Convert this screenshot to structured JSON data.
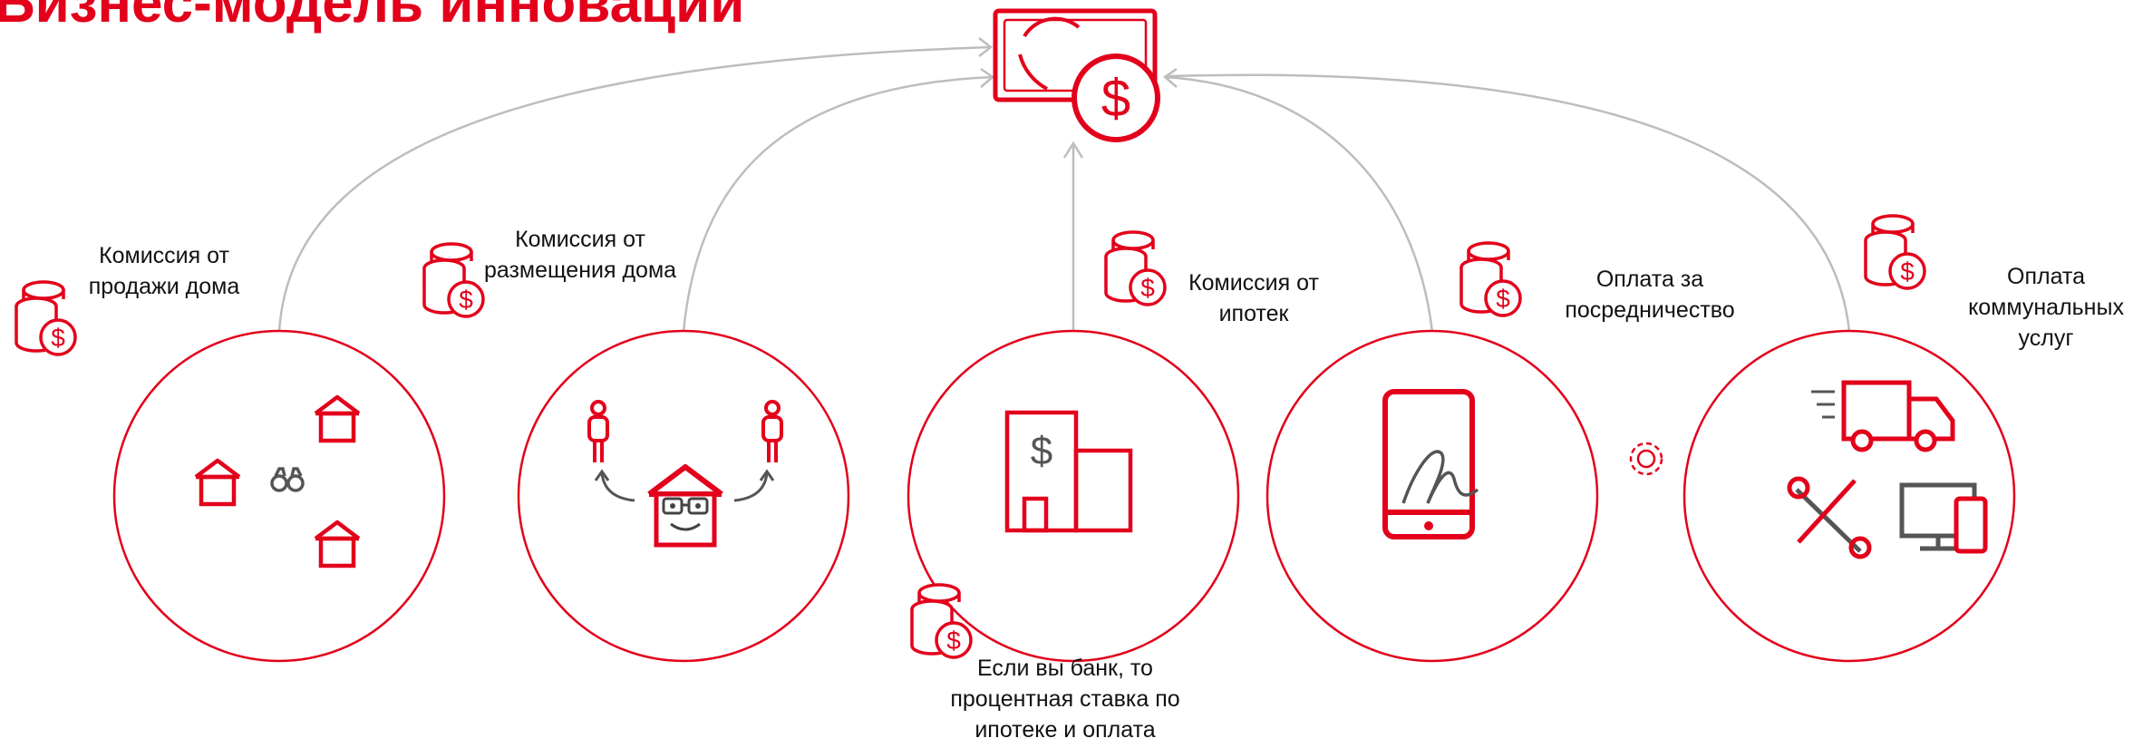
{
  "title": "Бизнес-модель инноваций",
  "colors": {
    "accent": "#e3001b",
    "line": "#bdbdbd",
    "text": "#111111",
    "gray": "#555555"
  },
  "center_icon": "money-dollar-icon",
  "revenue_streams": [
    {
      "label_lines": [
        "Комиссия от",
        "продажи дома"
      ],
      "circle_icons": [
        "house-icon",
        "binoculars-icon"
      ]
    },
    {
      "label_lines": [
        "Комиссия от",
        "размещения дома"
      ],
      "circle_icons": [
        "person-icon",
        "house-face-icon"
      ]
    },
    {
      "label_lines": [
        "Комиссия от",
        "ипотек"
      ],
      "circle_icons": [
        "bank-building-icon"
      ]
    },
    {
      "label_lines": [
        "Оплата за",
        "посредничество"
      ],
      "circle_icons": [
        "phone-signature-icon"
      ]
    },
    {
      "label_lines": [
        "Оплата",
        "коммунальных",
        "услуг"
      ],
      "circle_icons": [
        "truck-icon",
        "tools-icon",
        "devices-icon"
      ]
    }
  ],
  "bank_note": {
    "label_lines": [
      "Если вы банк, то",
      "процентная ставка по",
      "ипотеке и оплата"
    ]
  },
  "extra_icons": [
    "coins-dollar-icon",
    "gear-icon"
  ]
}
